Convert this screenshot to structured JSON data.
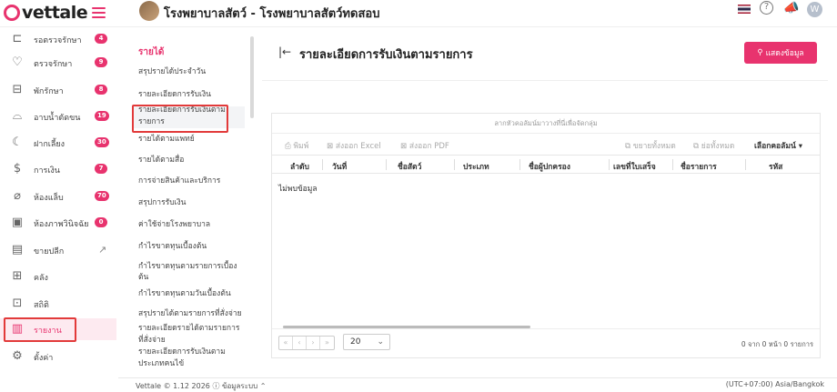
{
  "app": {
    "logo_text": "vettale",
    "hospital_name": "โรงพยาบาลสัตว์ - โรงพยาบาลสัตว์ทดสอบ",
    "user_initial": "W",
    "accent": "#e8336e"
  },
  "sidebar": {
    "items": [
      {
        "label": "รอตรวจรักษา",
        "icon": "queue-icon",
        "glyph": "⊏",
        "badge": "4"
      },
      {
        "label": "ตรวจรักษา",
        "icon": "stethoscope-icon",
        "glyph": "♡",
        "badge": "9"
      },
      {
        "label": "พักรักษา",
        "icon": "bed-icon",
        "glyph": "⊟",
        "badge": "8"
      },
      {
        "label": "อาบน้ำตัดขน",
        "icon": "bath-icon",
        "glyph": "⌓",
        "badge": "19"
      },
      {
        "label": "ฝากเลี้ยง",
        "icon": "moon-icon",
        "glyph": "☾",
        "badge": "30"
      },
      {
        "label": "การเงิน",
        "icon": "money-icon",
        "glyph": "$",
        "badge": "7"
      },
      {
        "label": "ห้องแล็บ",
        "icon": "test-tube-icon",
        "glyph": "⌀",
        "badge": "70"
      },
      {
        "label": "ห้องภาพวินิจฉัย",
        "icon": "xray-icon",
        "glyph": "▣",
        "badge": "0"
      },
      {
        "label": "ขายปลีก",
        "icon": "cash-register-icon",
        "glyph": "▤",
        "ext": "↗"
      },
      {
        "label": "คลัง",
        "icon": "inventory-icon",
        "glyph": "⊞"
      },
      {
        "label": "สถิติ",
        "icon": "stats-icon",
        "glyph": "⊡"
      },
      {
        "label": "รายงาน",
        "icon": "report-icon",
        "glyph": "▥"
      },
      {
        "label": "ตั้งค่า",
        "icon": "gear-icon",
        "glyph": "⚙"
      }
    ]
  },
  "submenu": {
    "title": "รายได้",
    "items": [
      "สรุปรายได้ประจำวัน",
      "รายละเอียดการรับเงิน",
      "รายละเอียดการรับเงินตาม",
      "รายการ",
      "รายได้ตามแพทย์",
      "รายได้ตามสื่อ",
      "การจ่ายสินค้าและบริการ",
      "สรุปการรับเงิน",
      "ค่าใช้จ่ายโรงพยาบาล",
      "กำไรขาดทุนเบื้องต้น",
      "กำไรขาดทุนตามรายการเบื้อง",
      "ต้น",
      "กำไรขาดทุนตามวันเบื้องต้น",
      "สรุปรายได้ตามรายการที่สั่งจ่าย",
      "รายละเอียดรายได้ตามรายการ",
      "ที่สั่งจ่าย",
      "รายละเอียดการรับเงินตาม",
      "ประเภทคนไข้"
    ]
  },
  "main": {
    "title": "รายละเอียดการรับเงินตามรายการ",
    "show_button": "แสดงข้อมูล",
    "group_hint": "ลากหัวคอลัมน์มาวางที่นี่เพื่อจัดกลุ่ม",
    "toolbar": {
      "print": "พิมพ์",
      "excel": "ส่งออก Excel",
      "pdf": "ส่งออก PDF",
      "expand": "ขยายทั้งหมด",
      "collapse": "ย่อทั้งหมด",
      "choose_cols": "เลือกคอลัมน์"
    },
    "columns": [
      "ลำดับ",
      "วันที่",
      "ชื่อสัตว์",
      "ประเภท",
      "ชื่อผู้ปกครอง",
      "เลขที่ใบเสร็จ",
      "ชื่อรายการ",
      "รหัส"
    ],
    "no_data": "ไม่พบข้อมูล",
    "pager": {
      "page_size": "20",
      "info": "0 จาก 0 หน้า 0 รายการ"
    }
  },
  "footer": {
    "left": "Vettale © 1.12 2026   ⓘ ข้อมูลระบบ ⌃",
    "right": "(UTC+07:00) Asia/Bangkok"
  }
}
